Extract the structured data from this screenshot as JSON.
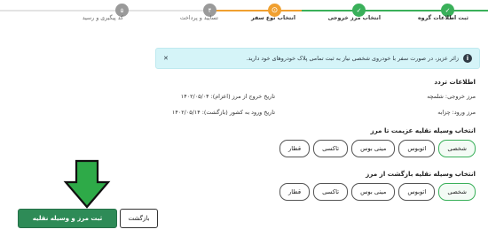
{
  "stepper": {
    "steps": [
      {
        "label": "ثبت اطلاعات گروه",
        "mark": "✓"
      },
      {
        "label": "انتخاب مرز خروجی",
        "mark": "✓"
      },
      {
        "label": "انتخاب نوع سفر",
        "mark": "⊙"
      },
      {
        "label": "تسایید و پرداخت",
        "mark": "۴"
      },
      {
        "label": "کد پیگیری و رسید",
        "mark": "۵"
      }
    ]
  },
  "alert": {
    "icon": "info-icon",
    "text": "زائر عزیز، در صورت سفر با خودروی شخصی نیاز به ثبت تمامی پلاک خودروهای خود دارید.",
    "dismiss": "✕"
  },
  "traffic_info": {
    "title": "اطلاعات تردد",
    "exit_border": "مرز خروجی: شلمچه",
    "exit_date": "تاریخ خروج از مرز (اعزام): ۱۴۰۲/۰۵/۰۴",
    "entry_border": "مرز ورود: چزابه",
    "entry_date": "تاریخ ورود به کشور (بازگشت): ۱۴۰۲/۰۵/۱۴"
  },
  "departure_vehicle": {
    "title": "انتخاب وسیله نقلیه عزیمت تا مرز",
    "options": [
      "شخصی",
      "اتوبوس",
      "مینی بوس",
      "تاکسی",
      "قطار"
    ],
    "selected": "شخصی"
  },
  "return_vehicle": {
    "title": "انتخاب وسیله نقلیه بازگشت از مرز",
    "options": [
      "شخصی",
      "اتوبوس",
      "مینی بوس",
      "تاکسی",
      "قطار"
    ],
    "selected": "شخصی"
  },
  "actions": {
    "submit": "ثبت مرز و وسیله نقلیه",
    "back": "بازگشت"
  },
  "colors": {
    "done": "#3ab05a",
    "active": "#f0a030",
    "pending": "#9a9a9a",
    "primary": "#2e8b57",
    "arrow": "#2eaa48"
  }
}
